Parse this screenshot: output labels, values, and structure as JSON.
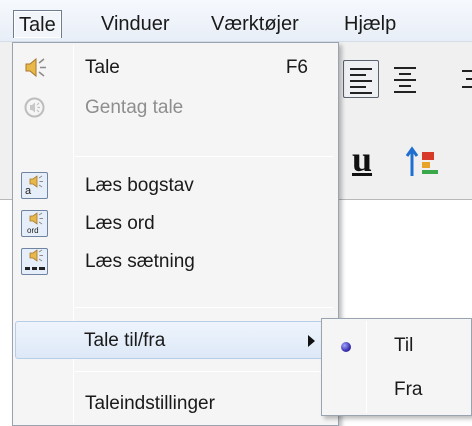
{
  "menubar": {
    "items": [
      {
        "label": "Tale"
      },
      {
        "label": "Vinduer"
      },
      {
        "label": "Værktøjer"
      },
      {
        "label": "Hjælp"
      }
    ]
  },
  "tale_menu": {
    "items": [
      {
        "label": "Tale",
        "shortcut": "F6",
        "icon": "speaker-icon",
        "enabled": true
      },
      {
        "label": "Gentag tale",
        "icon": "repeat-speech-icon",
        "enabled": false
      },
      {
        "label": "Læs bogstav",
        "icon": "read-letter-icon",
        "enabled": true
      },
      {
        "label": "Læs ord",
        "icon": "read-word-icon",
        "enabled": true
      },
      {
        "label": "Læs sætning",
        "icon": "read-sentence-icon",
        "enabled": true
      },
      {
        "label": "Tale til/fra",
        "icon": "submenu-arrow-icon",
        "enabled": true,
        "highlighted": true
      },
      {
        "label": "Taleindstillinger",
        "enabled": true
      }
    ]
  },
  "submenu": {
    "items": [
      {
        "label": "Til",
        "selected": true
      },
      {
        "label": "Fra",
        "selected": false
      }
    ]
  },
  "icon_text": {
    "letter": "a",
    "word": "ord"
  },
  "colors": {
    "menu_background": "#f5f5f5",
    "highlight": "#dde8f7",
    "speaker_yellow": "#e8b84a",
    "radio_dot": "#3a2fae"
  }
}
